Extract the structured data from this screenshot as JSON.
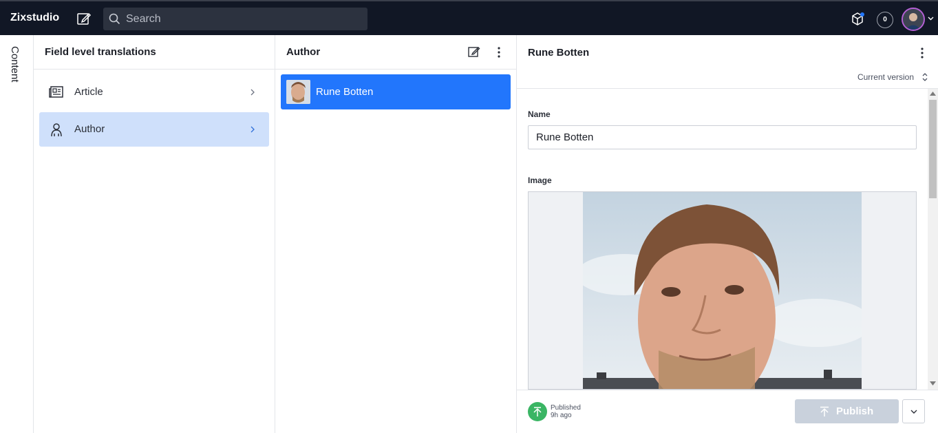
{
  "app": {
    "brand": "Zixstudio"
  },
  "search": {
    "placeholder": "Search"
  },
  "topbar": {
    "notifications_count": "0"
  },
  "rail": {
    "label": "Content"
  },
  "pane1": {
    "title": "Field level translations",
    "items": [
      {
        "label": "Article",
        "icon": "newspaper-icon",
        "active": false
      },
      {
        "label": "Author",
        "icon": "user-icon",
        "active": true
      }
    ]
  },
  "pane2": {
    "title": "Author",
    "documents": [
      {
        "label": "Rune Botten",
        "selected": true
      }
    ]
  },
  "pane3": {
    "title": "Rune Botten",
    "version_label": "Current version",
    "fields": {
      "name_label": "Name",
      "name_value": "Rune Botten",
      "image_label": "Image"
    },
    "footer": {
      "status": "Published",
      "status_time": "9h ago",
      "publish_label": "Publish"
    }
  },
  "colors": {
    "accent": "#2276fc",
    "topbar": "#111725",
    "selected_bg": "#cfe0fb",
    "published": "#3ab564"
  }
}
